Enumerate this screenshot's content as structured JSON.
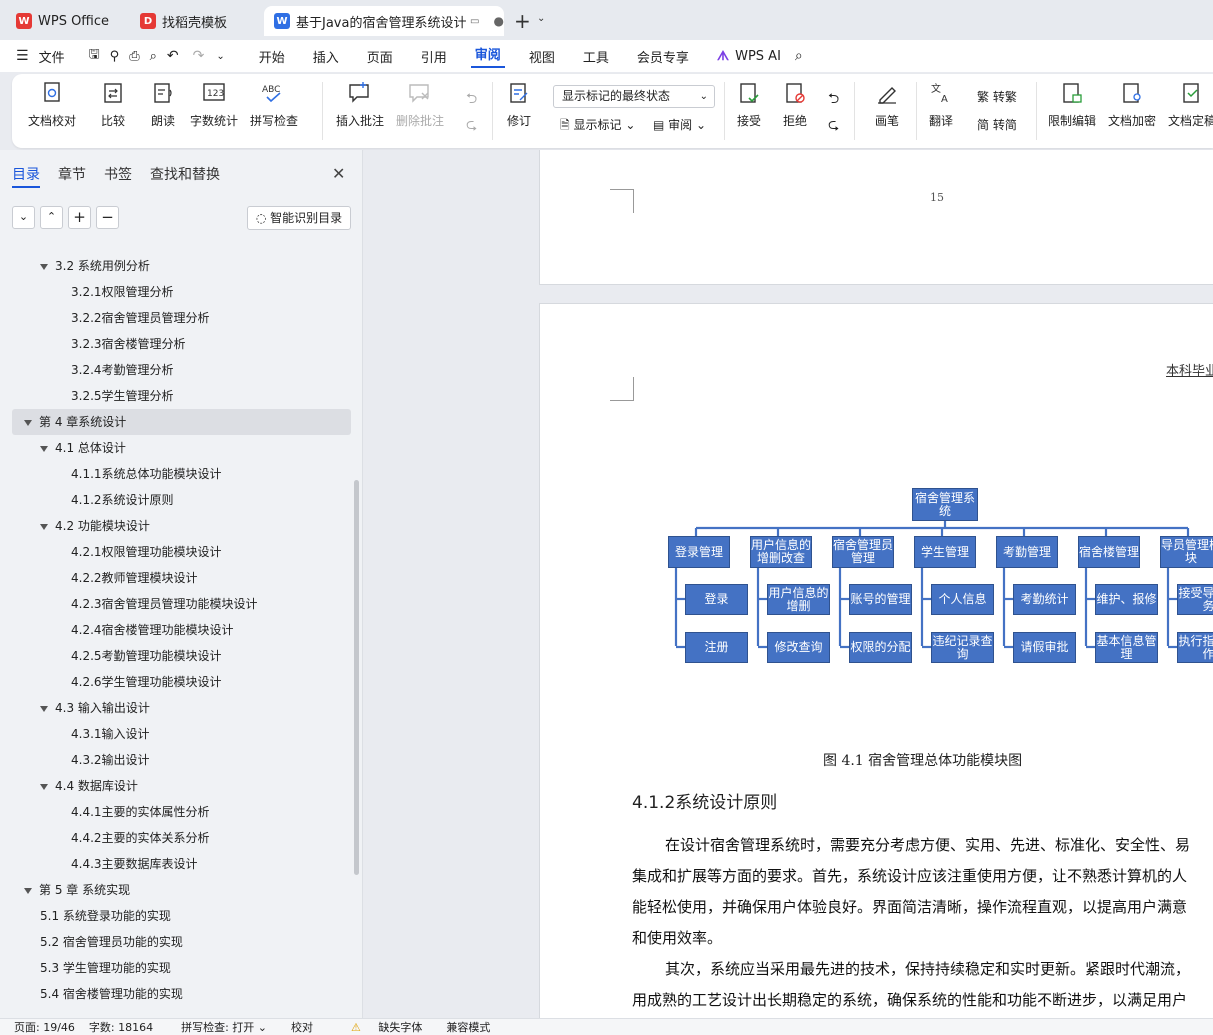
{
  "tabs": [
    {
      "label": "WPS Office"
    },
    {
      "label": "找稻壳模板"
    },
    {
      "label": "基于Java的宿舍管理系统设计与"
    }
  ],
  "menu": {
    "file": "文件",
    "items": [
      "开始",
      "插入",
      "页面",
      "引用",
      "审阅",
      "视图",
      "工具",
      "会员专享"
    ],
    "ai": "WPS AI"
  },
  "ribbon": {
    "doc_check": "文档校对",
    "compare": "比较",
    "read": "朗读",
    "word_count": "字数统计",
    "spell": "拼写检查",
    "insert_comment": "插入批注",
    "delete_comment": "删除批注",
    "revise": "修订",
    "markup_dropdown": "显示标记的最终状态",
    "show_markup": "显示标记",
    "review": "审阅",
    "accept": "接受",
    "reject": "拒绝",
    "pen": "画笔",
    "translate": "翻译",
    "to_trad": "转繁",
    "to_simp": "转简",
    "restrict": "限制编辑",
    "encrypt": "文档加密",
    "finalize": "文档定稿"
  },
  "sidebar": {
    "tabs": [
      "目录",
      "章节",
      "书签",
      "查找和替换"
    ],
    "smart_toc": "智能识别目录",
    "toc": [
      {
        "label": "3.2 系统用例分析",
        "level": 2,
        "expanded": true
      },
      {
        "label": "3.2.1权限管理分析",
        "level": 3
      },
      {
        "label": "3.2.2宿舍管理员管理分析",
        "level": 3
      },
      {
        "label": "3.2.3宿舍楼管理分析",
        "level": 3
      },
      {
        "label": "3.2.4考勤管理分析",
        "level": 3
      },
      {
        "label": "3.2.5学生管理分析",
        "level": 3
      },
      {
        "label": "第 4 章系统设计",
        "level": 1,
        "expanded": true,
        "selected": true
      },
      {
        "label": "4.1 总体设计",
        "level": 2,
        "expanded": true
      },
      {
        "label": "4.1.1系统总体功能模块设计",
        "level": 3
      },
      {
        "label": "4.1.2系统设计原则",
        "level": 3
      },
      {
        "label": "4.2 功能模块设计",
        "level": 2,
        "expanded": true
      },
      {
        "label": "4.2.1权限管理功能模块设计",
        "level": 3
      },
      {
        "label": "4.2.2教师管理模块设计",
        "level": 3
      },
      {
        "label": "4.2.3宿舍管理员管理功能模块设计",
        "level": 3
      },
      {
        "label": "4.2.4宿舍楼管理功能模块设计",
        "level": 3
      },
      {
        "label": "4.2.5考勤管理功能模块设计",
        "level": 3
      },
      {
        "label": "4.2.6学生管理功能模块设计",
        "level": 3
      },
      {
        "label": "4.3 输入输出设计",
        "level": 2,
        "expanded": true
      },
      {
        "label": "4.3.1输入设计",
        "level": 3
      },
      {
        "label": "4.3.2输出设计",
        "level": 3
      },
      {
        "label": "4.4 数据库设计",
        "level": 2,
        "expanded": true
      },
      {
        "label": "4.4.1主要的实体属性分析",
        "level": 3
      },
      {
        "label": "4.4.2主要的实体关系分析",
        "level": 3
      },
      {
        "label": "4.4.3主要数据库表设计",
        "level": 3
      },
      {
        "label": "第 5 章 系统实现",
        "level": 1,
        "expanded": true
      },
      {
        "label": "5.1 系统登录功能的实现",
        "level": 2
      },
      {
        "label": "5.2 宿舍管理员功能的实现",
        "level": 2
      },
      {
        "label": "5.3 学生管理功能的实现",
        "level": 2
      },
      {
        "label": "5.4 宿舍楼管理功能的实现",
        "level": 2
      }
    ]
  },
  "document": {
    "page_number": "15",
    "header_text": "本科毕业",
    "org": {
      "root": "宿舍管理系统",
      "modules": [
        {
          "name": "登录管理",
          "subs": [
            "登录",
            "注册"
          ]
        },
        {
          "name": "用户信息的增删改查",
          "subs": [
            "用户信息的增删",
            "修改查询"
          ]
        },
        {
          "name": "宿舍管理员管理",
          "subs": [
            "账号的管理",
            "权限的分配"
          ]
        },
        {
          "name": "学生管理",
          "subs": [
            "个人信息",
            "违纪记录查询"
          ]
        },
        {
          "name": "考勤管理",
          "subs": [
            "考勤统计",
            "请假审批"
          ]
        },
        {
          "name": "宿舍楼管理",
          "subs": [
            "维护、报修",
            "基本信息管理"
          ]
        },
        {
          "name": "导员管理模块",
          "subs": [
            "接受导员任务",
            "执行指派工作"
          ]
        }
      ]
    },
    "caption": "图 4.1 宿舍管理总体功能模块图",
    "heading": "4.1.2系统设计原则",
    "paragraphs": [
      "在设计宿舍管理系统时，需要充分考虑方便、实用、先进、标准化、安全性、易",
      "集成和扩展等方面的要求。首先，系统设计应该注重使用方便，让不熟悉计算机的人",
      "能轻松使用，并确保用户体验良好。界面简洁清晰，操作流程直观，以提高用户满意",
      "和使用效率。",
      "其次，系统应当采用最先进的技术，保持持续稳定和实时更新。紧跟时代潮流，",
      "用成熟的工艺设计出长期稳定的系统，确保系统的性能和功能不断进步，以满足用户"
    ]
  },
  "status": {
    "page": "页面: 19/46",
    "words": "字数: 18164",
    "spell": "拼写检查: 打开",
    "proof": "校对",
    "missing_font": "缺失字体",
    "compat": "兼容模式"
  }
}
